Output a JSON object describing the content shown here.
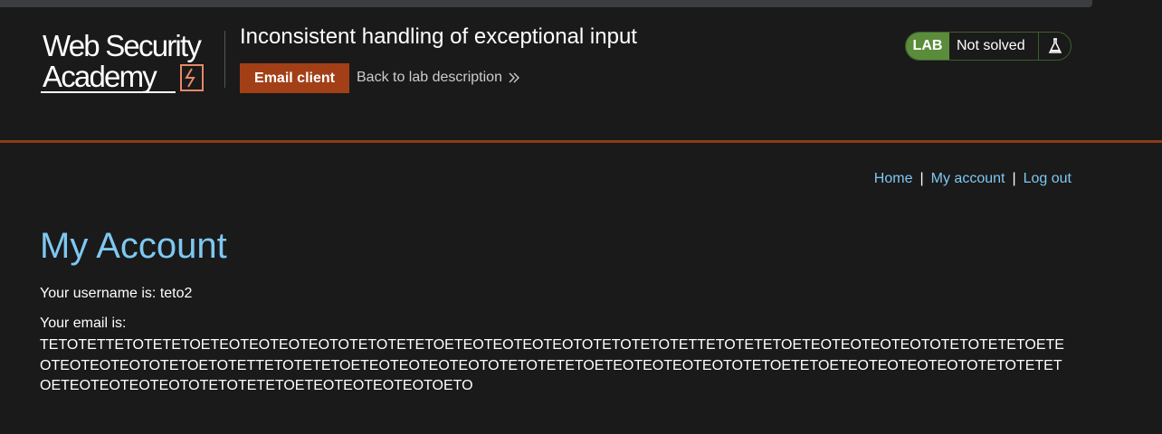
{
  "header": {
    "logo_line1": "Web Security",
    "logo_line2": "Academy",
    "lab_title": "Inconsistent handling of exceptional input",
    "email_client_label": "Email client",
    "back_link_label": "Back to lab description",
    "lab_badge_label": "LAB",
    "lab_status": "Not solved",
    "icons": {
      "back": "chevrons-right-icon",
      "lab": "flask-icon"
    },
    "colors": {
      "accent": "#a33f17",
      "lab_green": "#5b8c3c",
      "divider": "#8c3b18"
    }
  },
  "nav": {
    "home": "Home",
    "my_account": "My account",
    "log_out": "Log out",
    "separator": "|"
  },
  "main": {
    "title": "My Account",
    "username_line": "Your username is: teto2",
    "email_label": "Your email is:",
    "email_value": "TETOTETTETOTETETOETEOTEOTEOTEOTOTETOTETETOETEOTEOTEOTEOTOTETOTETOTETTETOTETETOETEOTEOTEOTEOTOTETOTETETOETEOTEOTEOTEOTOTETOETOTETTETOTETETOETEOTEOTEOTEOTOTETOTETETOETEOTEOTEOTEOTOTETOETETOETEOTEOTEOTEOTOTETOTETETOETEOTEOTEOTEOTOTETOTETETOETEOTEOTEOTEOTOETO",
    "link_color": "#7ec8f2"
  }
}
